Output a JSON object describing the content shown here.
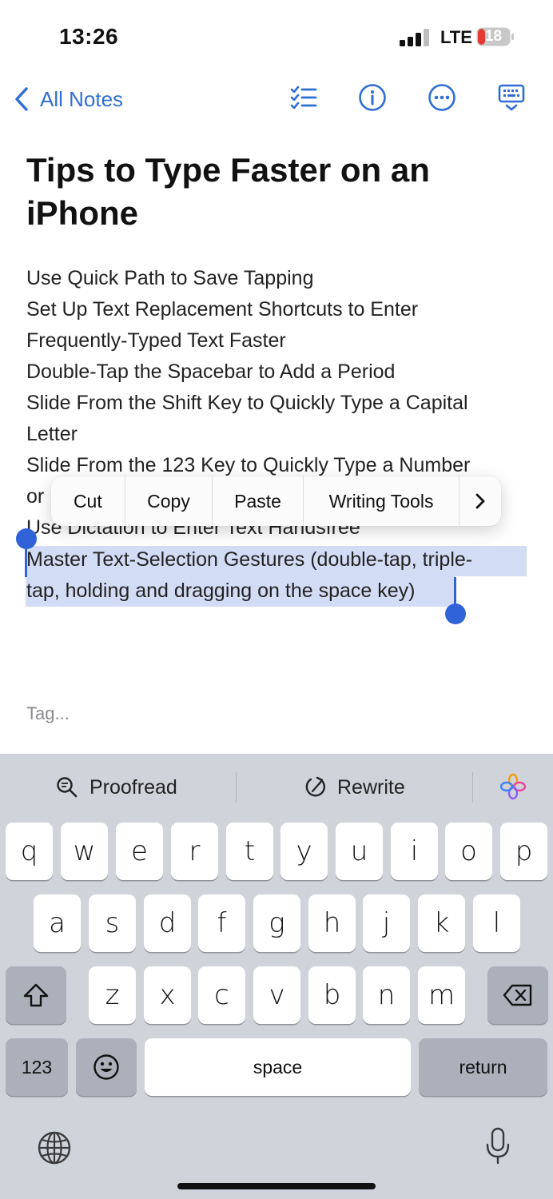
{
  "status": {
    "time": "13:26",
    "network": "LTE",
    "battery": "18"
  },
  "nav": {
    "back_label": "All Notes"
  },
  "note": {
    "title_lines": [
      "Tips to Type Faster on an",
      "iPhone"
    ],
    "lines": [
      "Use Quick Path to Save Tapping",
      "Set Up Text Replacement Shortcuts to Enter",
      "Frequently-Typed Text Faster",
      "Double-Tap the Spacebar to Add a Period",
      "Slide From the Shift Key to Quickly Type a Capital",
      "Letter",
      "Slide From the 123 Key to Quickly Type a Number",
      "or",
      "Use Dictation to Enter Text Handsfree",
      "Master Text-Selection Gestures (double-tap, triple-",
      "tap, holding and dragging on the space key)"
    ],
    "tag_placeholder": "Tag..."
  },
  "context_menu": {
    "items": [
      "Cut",
      "Copy",
      "Paste",
      "Writing Tools"
    ]
  },
  "keyboard": {
    "suggestions": [
      "Proofread",
      "Rewrite"
    ],
    "row1": [
      "q",
      "w",
      "e",
      "r",
      "t",
      "y",
      "u",
      "i",
      "o",
      "p"
    ],
    "row2": [
      "a",
      "s",
      "d",
      "f",
      "g",
      "h",
      "j",
      "k",
      "l"
    ],
    "row3": [
      "z",
      "x",
      "c",
      "v",
      "b",
      "n",
      "m"
    ],
    "numbers_label": "123",
    "space_label": "space",
    "return_label": "return"
  },
  "colors": {
    "accent": "#2f6fd3",
    "selection": "#d3dcf5",
    "keyboard_bg": "#d0d3da"
  }
}
